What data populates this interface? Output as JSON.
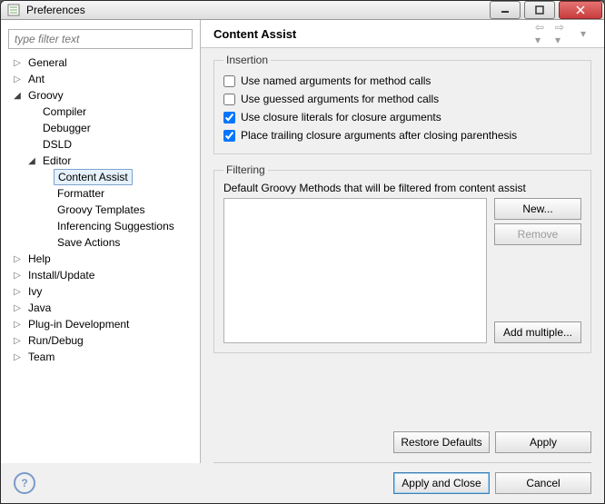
{
  "window": {
    "title": "Preferences"
  },
  "filter": {
    "placeholder": "type filter text"
  },
  "tree": {
    "general": "General",
    "ant": "Ant",
    "groovy": "Groovy",
    "compiler": "Compiler",
    "debugger": "Debugger",
    "dsld": "DSLD",
    "editor": "Editor",
    "contentAssist": "Content Assist",
    "formatter": "Formatter",
    "groovyTemplates": "Groovy Templates",
    "inferencing": "Inferencing Suggestions",
    "saveActions": "Save Actions",
    "help": "Help",
    "installUpdate": "Install/Update",
    "ivy": "Ivy",
    "java": "Java",
    "plugin": "Plug-in Development",
    "runDebug": "Run/Debug",
    "team": "Team"
  },
  "page": {
    "title": "Content Assist",
    "insertion": {
      "legend": "Insertion",
      "namedArgs": {
        "label": "Use named arguments for method calls",
        "checked": false
      },
      "guessedArgs": {
        "label": "Use guessed arguments for method calls",
        "checked": false
      },
      "closureLiterals": {
        "label": "Use closure literals for closure arguments",
        "checked": true
      },
      "trailingClosure": {
        "label": "Place trailing closure arguments after closing parenthesis",
        "checked": true
      }
    },
    "filtering": {
      "legend": "Filtering",
      "desc": "Default Groovy Methods that will be filtered from content assist",
      "new": "New...",
      "remove": "Remove",
      "addMultiple": "Add multiple..."
    }
  },
  "buttons": {
    "restoreDefaults": "Restore Defaults",
    "apply": "Apply",
    "applyClose": "Apply and Close",
    "cancel": "Cancel"
  }
}
